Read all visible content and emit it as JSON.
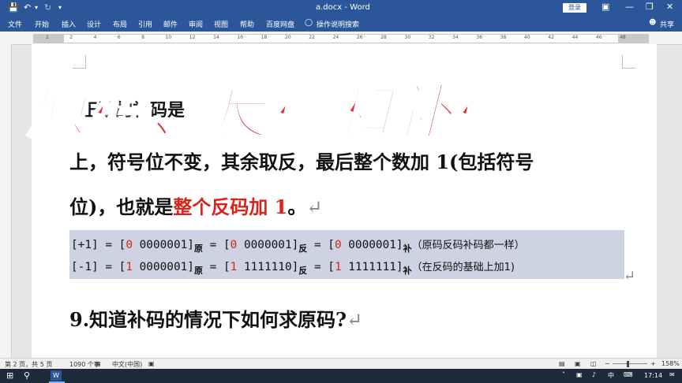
{
  "titlebar": {
    "title": "a.docx  -  Word",
    "login_label": "登录",
    "save_icon": "save-icon",
    "undo_icon": "undo-icon",
    "redo_icon": "redo-icon",
    "customize_icon": "customize-icon"
  },
  "ribbon": {
    "tabs": [
      "文件",
      "开始",
      "插入",
      "设计",
      "布局",
      "引用",
      "邮件",
      "审阅",
      "视图",
      "帮助",
      "百度网盘"
    ],
    "tell_me": "操作说明搜索",
    "share": "共享"
  },
  "ruler": {
    "numbers": [
      "2",
      "2",
      "4",
      "6",
      "8",
      "10",
      "12",
      "14",
      "16",
      "18",
      "20",
      "22",
      "24",
      "26",
      "28",
      "30",
      "32",
      "34",
      "36",
      "38",
      "40",
      "42",
      "44",
      "46",
      "48"
    ]
  },
  "document": {
    "line1_start": "正数的补码是",
    "line2": "上，符号位不变，其余取反，最后整个数加 1(包括符号",
    "line3_prefix": "位)，也就是",
    "line3_highlight": "整个反码加 1",
    "line3_suffix": "。",
    "return_mark": "↵",
    "code": {
      "row1": {
        "a1": "[+1] = [",
        "a2": "0",
        "a3": " 0000001]",
        "s1": "原",
        "b1": " = [",
        "b2": "0",
        "b3": " 0000001]",
        "s2": "反",
        "c1": " = [",
        "c2": "0",
        "c3": " 0000001]",
        "s3": "补",
        "note": "（原码反码补码都一样）"
      },
      "row2": {
        "a1": "[-1] = [",
        "a2": "1",
        "a3": " 0000001]",
        "s1": "原",
        "b1": " = [",
        "b2": "1",
        "b3": " 1111110]",
        "s2": "反",
        "c1": " = [",
        "c2": "1",
        "c3": " 1111111]",
        "s3": "补",
        "note": "（在反码的基础上加1)"
      }
    },
    "heading9": "9.知道补码的情况下如何求原码?"
  },
  "overlay_title": "原码、反码和补码",
  "statusbar": {
    "page": "第 2 页，共 5 页",
    "words": "1090 个字",
    "language": "中文(中国)",
    "zoom": "158%"
  },
  "taskbar": {
    "time": "17:14",
    "ime": "中"
  },
  "colors": {
    "word_blue": "#2b579a",
    "red": "#d9241b",
    "code_bg": "#cdd3e2",
    "title_red": "#df2f3a"
  }
}
